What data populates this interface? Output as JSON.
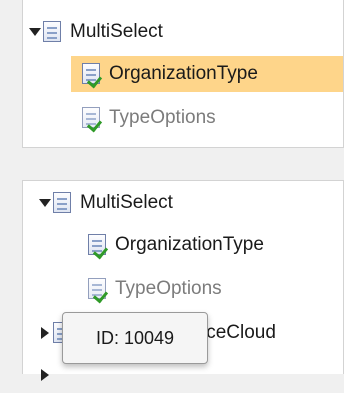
{
  "top_tree": {
    "nodes": [
      {
        "label": "MultiSelect",
        "icon": "form-icon",
        "expanded": true
      },
      {
        "label": "OrganizationType",
        "icon": "field-check-icon",
        "selected": true
      },
      {
        "label": "TypeOptions",
        "icon": "field-check-icon",
        "muted": true
      }
    ]
  },
  "bottom_tree": {
    "nodes": [
      {
        "label": "MultiSelect",
        "icon": "form-icon",
        "expanded": true
      },
      {
        "label": "OrganizationType",
        "icon": "field-check-icon"
      },
      {
        "label": "TypeOptions",
        "icon": "field-check-icon",
        "muted": true
      },
      {
        "label": "iceCloud",
        "icon": "form-icon",
        "expanded": false,
        "partially_obscured": true
      }
    ]
  },
  "tooltip": {
    "text": "ID: 10049"
  },
  "colors": {
    "selection": "#fed58a",
    "muted_text": "#7c7c7c",
    "check": "#2f9a28"
  }
}
